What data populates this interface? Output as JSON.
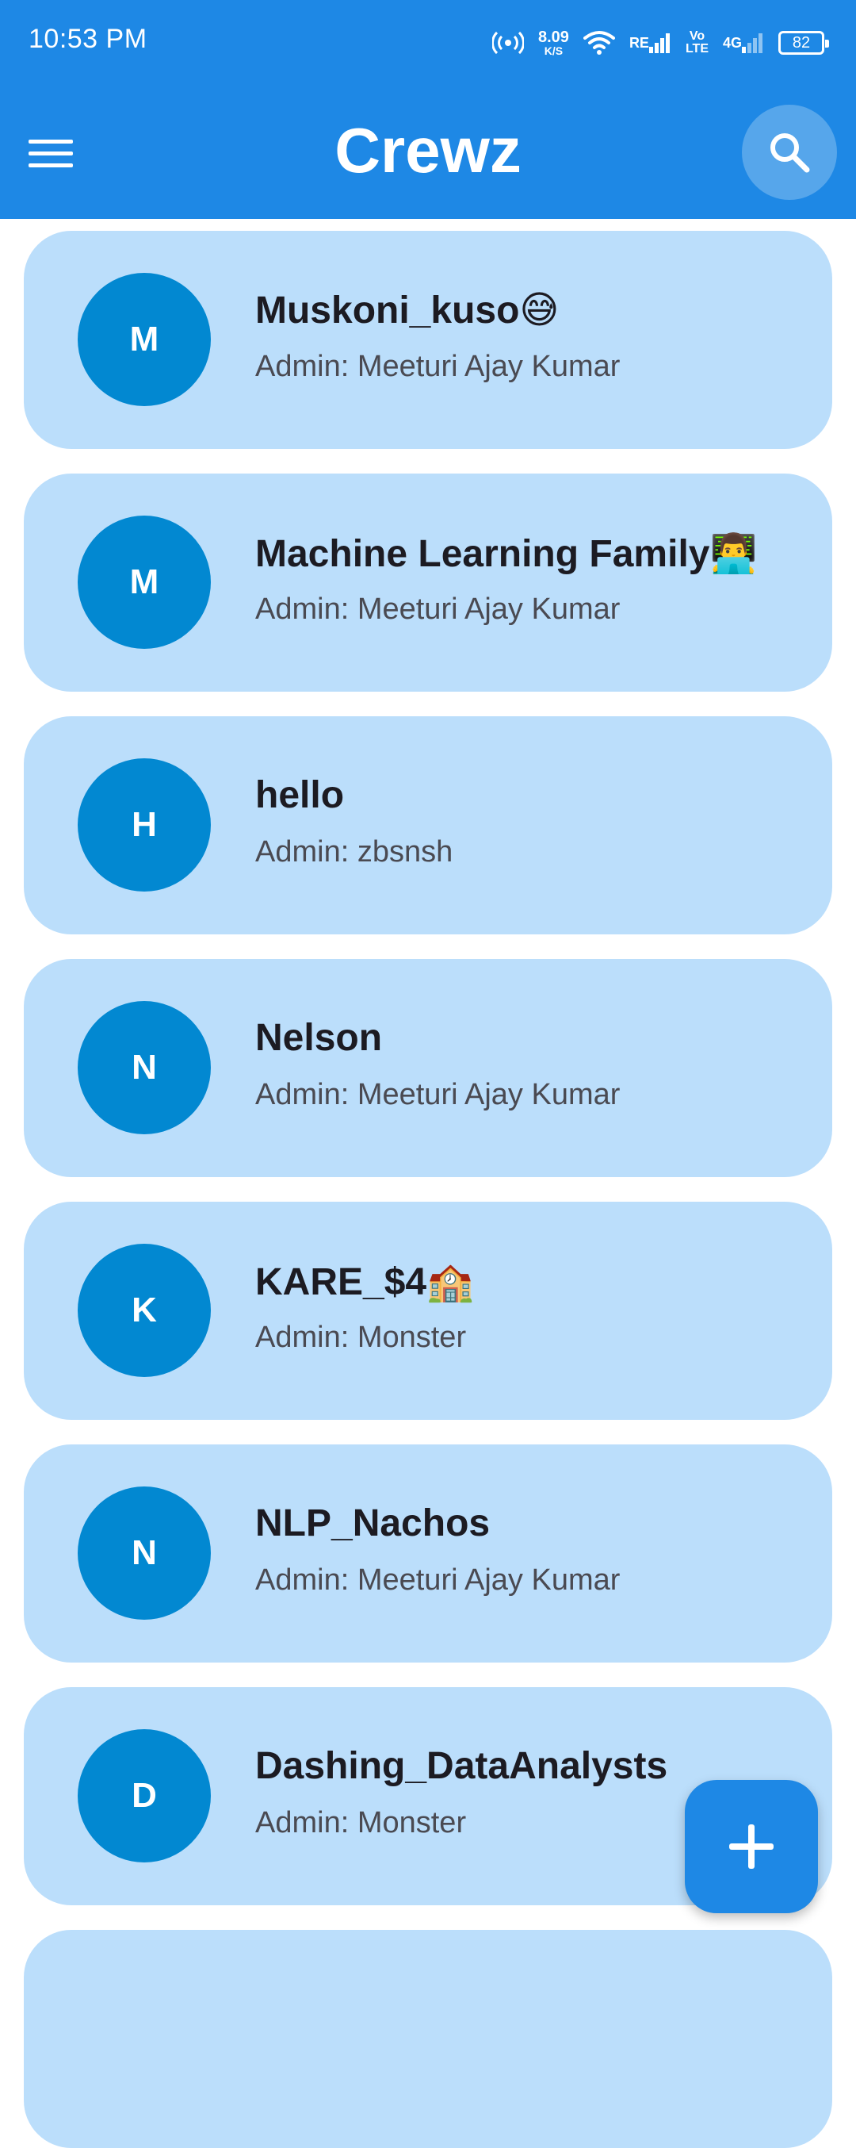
{
  "status_bar": {
    "time": "10:53 PM",
    "net_speed_value": "8.09",
    "net_speed_unit": "K/S",
    "signal1_label": "RE",
    "volte_top": "Vo",
    "volte_bottom": "LTE",
    "signal2_label": "4G",
    "battery": "82"
  },
  "app_bar": {
    "title": "Crewz",
    "menu_icon": "hamburger-menu-icon",
    "search_icon": "search-icon"
  },
  "crews": [
    {
      "initial": "M",
      "name": "Muskoni_kuso😅",
      "admin": "Admin: Meeturi Ajay Kumar"
    },
    {
      "initial": "M",
      "name": "Machine Learning Family👨‍💻",
      "admin": "Admin: Meeturi Ajay Kumar"
    },
    {
      "initial": "H",
      "name": "hello",
      "admin": "Admin: zbsnsh"
    },
    {
      "initial": "N",
      "name": "Nelson",
      "admin": "Admin: Meeturi Ajay Kumar"
    },
    {
      "initial": "K",
      "name": "KARE_$4🏫",
      "admin": "Admin: Monster"
    },
    {
      "initial": "N",
      "name": "NLP_Nachos",
      "admin": "Admin: Meeturi Ajay Kumar"
    },
    {
      "initial": "D",
      "name": "Dashing_DataAnalysts",
      "admin": "Admin: Monster"
    }
  ],
  "fab": {
    "icon": "plus-icon"
  },
  "colors": {
    "primary": "#1e88e5",
    "card": "#bbdefb",
    "avatar": "#0288d1"
  }
}
